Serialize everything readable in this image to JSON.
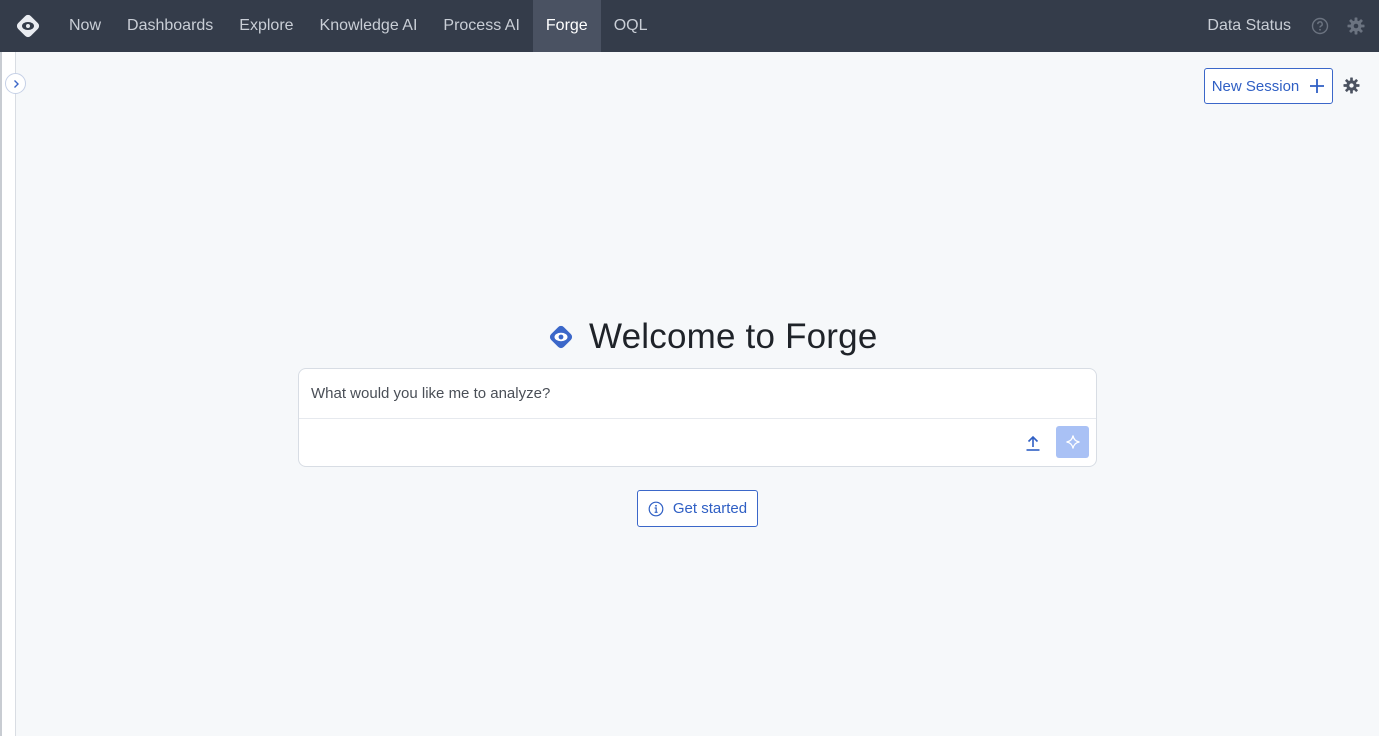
{
  "nav": {
    "items": [
      {
        "label": "Now"
      },
      {
        "label": "Dashboards"
      },
      {
        "label": "Explore"
      },
      {
        "label": "Knowledge AI"
      },
      {
        "label": "Process AI"
      },
      {
        "label": "Forge",
        "active": true
      },
      {
        "label": "OQL"
      }
    ],
    "data_status": "Data Status",
    "icons": [
      "app-logo-icon",
      "help-icon",
      "gear-icon"
    ]
  },
  "sidebar": {
    "toggle_icon": "chevron-right-icon"
  },
  "session": {
    "new_session_label": "New Session",
    "new_session_icon": "plus-icon",
    "settings_icon": "gear-icon"
  },
  "welcome": {
    "title": "Welcome to Forge",
    "logo_icon": "forge-logo-icon"
  },
  "prompt": {
    "placeholder": "What would you like me to analyze?",
    "value": "",
    "upload_icon": "upload-icon",
    "submit_icon": "sparkle-icon"
  },
  "get_started": {
    "label": "Get started",
    "icon": "info-icon"
  },
  "colors": {
    "nav_bg": "#343c4a",
    "nav_active_bg": "#4a5262",
    "accent": "#2f5fc4",
    "page_bg": "#f6f8fa",
    "submit_bg": "#a9c1f5"
  }
}
